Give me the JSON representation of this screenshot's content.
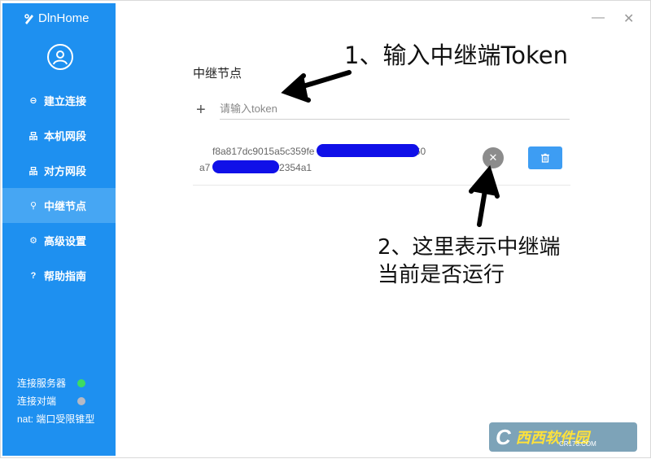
{
  "app": {
    "brand": "DlnHome"
  },
  "sidebar": {
    "items": [
      {
        "label": "建立连接",
        "icon": "link-icon",
        "glyph": "⊖"
      },
      {
        "label": "本机网段",
        "icon": "network-icon",
        "glyph": "品"
      },
      {
        "label": "对方网段",
        "icon": "network-icon",
        "glyph": "品"
      },
      {
        "label": "中继节点",
        "icon": "relay-icon",
        "glyph": "⚲"
      },
      {
        "label": "高级设置",
        "icon": "settings-icon",
        "glyph": "⚙"
      },
      {
        "label": "帮助指南",
        "icon": "help-icon",
        "glyph": "?"
      }
    ],
    "active_index": 3,
    "status": [
      {
        "label": "连接服务器",
        "color": "#3ddc62"
      },
      {
        "label": "连接对端",
        "color": "#b6b9c4"
      },
      {
        "label": "nat: 端口受限锥型"
      }
    ]
  },
  "window": {
    "minimize": "—",
    "close": "✕"
  },
  "main": {
    "section_title": "中继节点",
    "token_placeholder": "请输入token",
    "nodes": [
      {
        "token_line1": "f8a817dc9015a5c359fe",
        "token_line1_end": "1060",
        "token_line2": "a7",
        "token_line2_end": "72354a1",
        "status_glyph": "✕"
      }
    ]
  },
  "annotations": {
    "note1": "1、输入中继端Token",
    "note2": "2、这里表示中继端当前是否运行"
  },
  "watermark": {
    "logo": "C",
    "text": "西西软件园",
    "sub": "CR173.COM"
  },
  "colors": {
    "sidebar": "#1e90f0",
    "active": "#46a6f3",
    "accent": "#3d9df3"
  }
}
